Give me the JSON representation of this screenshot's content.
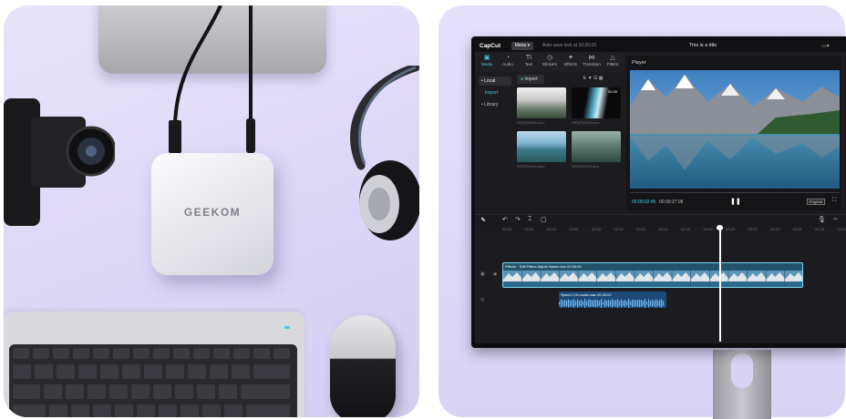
{
  "left_scene": {
    "device_brand": "GEEKOM"
  },
  "editor": {
    "app_name": "CapCut",
    "menu_label": "Menu",
    "autosave": "Auto save lock at 16:20:29",
    "doc_title": "This is a title",
    "toolbar": [
      {
        "label": "Media",
        "icon": "▣",
        "active": true
      },
      {
        "label": "Audio",
        "icon": "◔"
      },
      {
        "label": "Text",
        "icon": "TI"
      },
      {
        "label": "Stickers",
        "icon": "◷"
      },
      {
        "label": "Effects",
        "icon": "✦"
      },
      {
        "label": "Transition",
        "icon": "⋈"
      },
      {
        "label": "Filters",
        "icon": "△"
      }
    ],
    "sidebar": {
      "local": "• Local",
      "import": "Import",
      "library": "• Library"
    },
    "media": {
      "import_btn": "Import",
      "items": [
        {
          "name": "DRQTNG04.mov",
          "badge": ""
        },
        {
          "name": "DRQTNG04.mov",
          "badge": "00:39"
        },
        {
          "name": "DRQTNG04.mov",
          "badge": ""
        },
        {
          "name": "DRQTNG04.mov",
          "badge": ""
        }
      ]
    },
    "player": {
      "label": "Player",
      "time_current": "00:00:02:45",
      "time_total": "00:00:27:08",
      "original_btn": "Original"
    },
    "timeline": {
      "ruler": [
        "00:00",
        "00:02",
        "00:04",
        "00:06",
        "00:08",
        "00:10",
        "00:12",
        "00:14",
        "00:16",
        "00:18",
        "00:20",
        "00:22",
        "00:24",
        "00:26",
        "00:28",
        "00:30"
      ],
      "video_clip_label": "Effects · Edit   Filters   Adjust   Name.mov   00:00:00",
      "audio_clip_label": "Speed 2.0x   Audio.aac   00:00:00"
    }
  }
}
